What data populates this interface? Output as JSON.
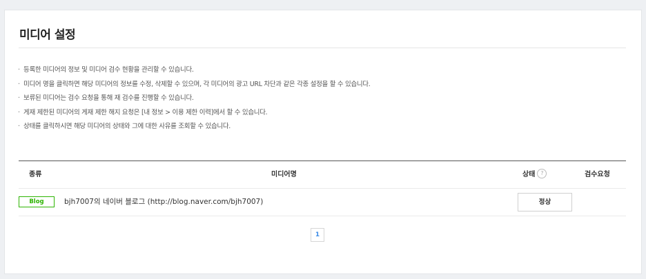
{
  "page": {
    "title": "미디어 설정"
  },
  "notes": [
    "등록한 미디어의 정보 및 미디어 검수 현황을 관리할 수 있습니다.",
    "미디어 명을 클릭하면 해당 미디어의 정보를 수정, 삭제할 수 있으며, 각 미디어의 광고 URL 차단과 같은 각종 설정을 할 수 있습니다.",
    "보류된 미디어는 검수 요청을 통해 재 검수를 진행할 수 있습니다.",
    "게재 제한된 미디어의 게재 제한 해지 요청은 [내 정보 > 이용 제한 이력]에서 할 수 있습니다.",
    "상태를 클릭하시면 해당 미디어의 상태와 그에 대한 사유를 조회할 수 있습니다."
  ],
  "note_bullet": "·",
  "table": {
    "headers": {
      "type": "종류",
      "name": "미디어명",
      "status": "상태",
      "review": "검수요청"
    },
    "help_icon": "?",
    "rows": [
      {
        "type": "Blog",
        "name": "bjh7007의 네이버 블로그 (http://blog.naver.com/bjh7007)",
        "status": "정상",
        "review": ""
      }
    ]
  },
  "pagination": {
    "current": "1"
  },
  "colors": {
    "accent_green": "#2db400",
    "page_link_blue": "#3c8ce7"
  }
}
